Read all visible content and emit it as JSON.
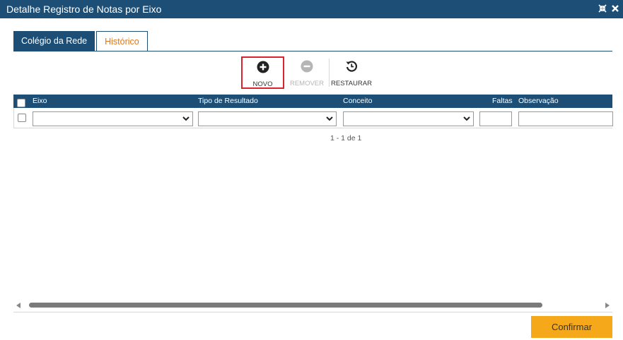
{
  "window": {
    "title": "Detalhe Registro de Notas por Eixo",
    "icons": [
      "collapse-icon",
      "close-icon"
    ]
  },
  "tabs": [
    {
      "label": "Colégio da Rede",
      "active": true
    },
    {
      "label": "Histórico",
      "active": false
    }
  ],
  "toolbar": {
    "novo_label": "NOVO",
    "remover_label": "REMOVER",
    "restaurar_label": "RESTAURAR"
  },
  "grid": {
    "columns": [
      "Eixo",
      "Tipo de Resultado",
      "Conceito",
      "Faltas",
      "Observação"
    ],
    "rows": [
      {
        "eixo": "",
        "tipo_resultado": "",
        "conceito": "",
        "faltas": "",
        "observacao": ""
      }
    ]
  },
  "pager": {
    "text": "1 - 1 de 1"
  },
  "footer": {
    "confirm_label": "Confirmar"
  },
  "colors": {
    "primary": "#1d4f76",
    "accent": "#f5a91a",
    "tab_inactive_text": "#e0761a",
    "highlight": "#d9232d"
  }
}
